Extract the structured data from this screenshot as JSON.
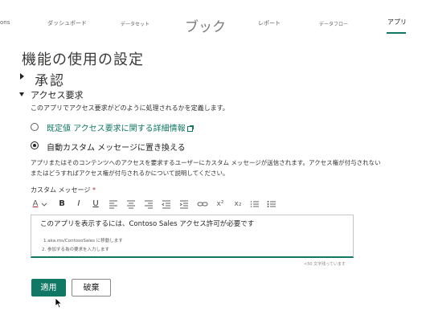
{
  "topnav": {
    "items": [
      {
        "label": "ons"
      },
      {
        "label": "ダッシュボード"
      },
      {
        "label": "データセット"
      },
      {
        "label": "ブック"
      },
      {
        "label": "レポート"
      },
      {
        "label": "データフロー"
      },
      {
        "label": "アプリ",
        "active": true
      }
    ],
    "accent_color": "#117865"
  },
  "page": {
    "title": "機能の使用の設定",
    "approval_label": "承認",
    "access_section_label": "アクセス要求",
    "access_description": "このアプリでアクセス要求がどのように処理されるかを定義します。",
    "options": [
      {
        "label": "既定値 アクセス要求に関する詳細情報",
        "selected": false,
        "has_external_link_icon": true
      },
      {
        "label": "自動カスタム メッセージに置き換える",
        "selected": true
      }
    ],
    "custom_description_line1": "アプリまたはそのコンテンツへのアクセスを要求するユーザーにカスタム メッセージが送信されます。アクセス権が付与されない",
    "custom_description_line2": "またはどうすればアクセス権が付与されるかについて説明してください。",
    "custom_message_label": "カスタム メッセージ",
    "required_mark": "*",
    "toolbar": {
      "font_color": "A",
      "bold": "B",
      "italic": "I",
      "underline": "U",
      "superscript": "x²",
      "subscript": "x₂"
    },
    "editor": {
      "line1": "このアプリを表示するには、Contoso Sales アクセス許可が必要です",
      "line2": "1.aka.ms/ContosoSales に移動します",
      "line3": "2.  参加する為の要求を入力します"
    },
    "char_count": "<50 文字残っています",
    "apply_button": "適用",
    "discard_button": "破棄"
  }
}
